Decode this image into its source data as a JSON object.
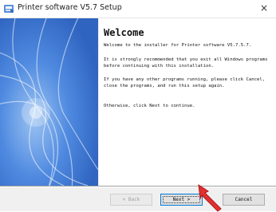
{
  "window": {
    "title": "Printer software V5.7 Setup",
    "close_label": "×"
  },
  "content": {
    "heading": "Welcome",
    "paragraphs": [
      "Welcome to the installer for Printer software V5.7.5.7.",
      "It is strongly recommended that you exit all Windows programs before continuing with this installation.",
      "If you have any other programs running, please click Cancel, close the programs, and run this setup again.",
      "Otherwise, click Next to continue."
    ]
  },
  "buttons": {
    "back": "< Back",
    "next": "Next >",
    "cancel": "Cancel"
  },
  "colors": {
    "side_panel": "#3d7ad6",
    "cursor": "#e03030",
    "focus_border": "#0078d7"
  },
  "icons": {
    "app": "printer-setup-icon",
    "pointer": "red-arrow-cursor-icon"
  }
}
